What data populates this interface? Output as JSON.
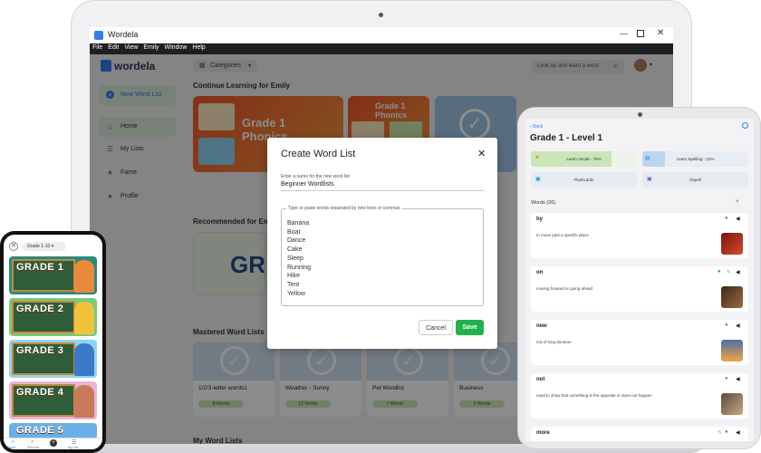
{
  "app": {
    "title": "Wordela",
    "menu": [
      "File",
      "Edit",
      "View",
      "Emily",
      "Window",
      "Help"
    ],
    "logo": "wordela",
    "categories_label": "Categories",
    "search_placeholder": "Look up and learn a word",
    "accent": "#2f80ed"
  },
  "sidebar": {
    "new_list": "New Word List",
    "items": [
      {
        "label": "Home",
        "icon": "home-icon"
      },
      {
        "label": "My Lists",
        "icon": "list-icon"
      },
      {
        "label": "Fame",
        "icon": "star-icon"
      },
      {
        "label": "Profile",
        "icon": "person-icon"
      }
    ]
  },
  "main": {
    "continue_title": "Continue Learning for Emily",
    "recommended_title": "Recommended for Emily",
    "mastered_title": "Mastered Word Lists",
    "my_lists_title": "My Word Lists",
    "continue_cards": [
      {
        "text": "Grade 1\nPhonics"
      },
      {
        "text": "Grade 1\nPhonics"
      }
    ],
    "recommended_banner": "GR",
    "mastered": [
      {
        "name": "1/2/3-letter words1",
        "words": "8 Words"
      },
      {
        "name": "Weather - Sunny",
        "words": "12 Words"
      },
      {
        "name": "Pet Wordlist",
        "words": "7 Words"
      },
      {
        "name": "Business",
        "words": "9 Words"
      }
    ]
  },
  "dialog": {
    "title": "Create Word List",
    "name_label": "Enter a name for the new word list",
    "name_value": "Beginner Wordlists",
    "words_label": "Type or paste words separated by new lines or commas",
    "words": [
      "Banana",
      "Boat",
      "Dance",
      "Cake",
      "Sleep",
      "Running",
      "Hike",
      "Tent",
      "Yellow"
    ],
    "cancel": "Cancel",
    "save": "Save",
    "save_color": "#22b14c"
  },
  "tablet": {
    "back": "Back",
    "title": "Grade 1 - Level 1",
    "learn_vocab": "Learn Vocab - 76%",
    "learn_vocab_progress": 0.76,
    "learn_spelling": "Learn Spelling - 21%",
    "learn_spelling_progress": 0.21,
    "flashcards": "Flashcards",
    "zspell": "ZSpell",
    "words_header": "Words (26)",
    "words": [
      {
        "word": "by",
        "def": "to move past a specific place"
      },
      {
        "word": "on",
        "def": "moving forward or going ahead"
      },
      {
        "word": "new",
        "def": "not of long duration"
      },
      {
        "word": "not",
        "def": "used to show that something is the opposite or does not happen"
      },
      {
        "word": "more",
        "def": ""
      }
    ]
  },
  "phone": {
    "filter": "Grade 1-10",
    "grades": [
      "GRADE 1",
      "GRADE 2",
      "GRADE 3",
      "GRADE 4",
      "GRADE 5"
    ],
    "tabs": [
      "Home",
      "Discover",
      "",
      "My List"
    ]
  }
}
